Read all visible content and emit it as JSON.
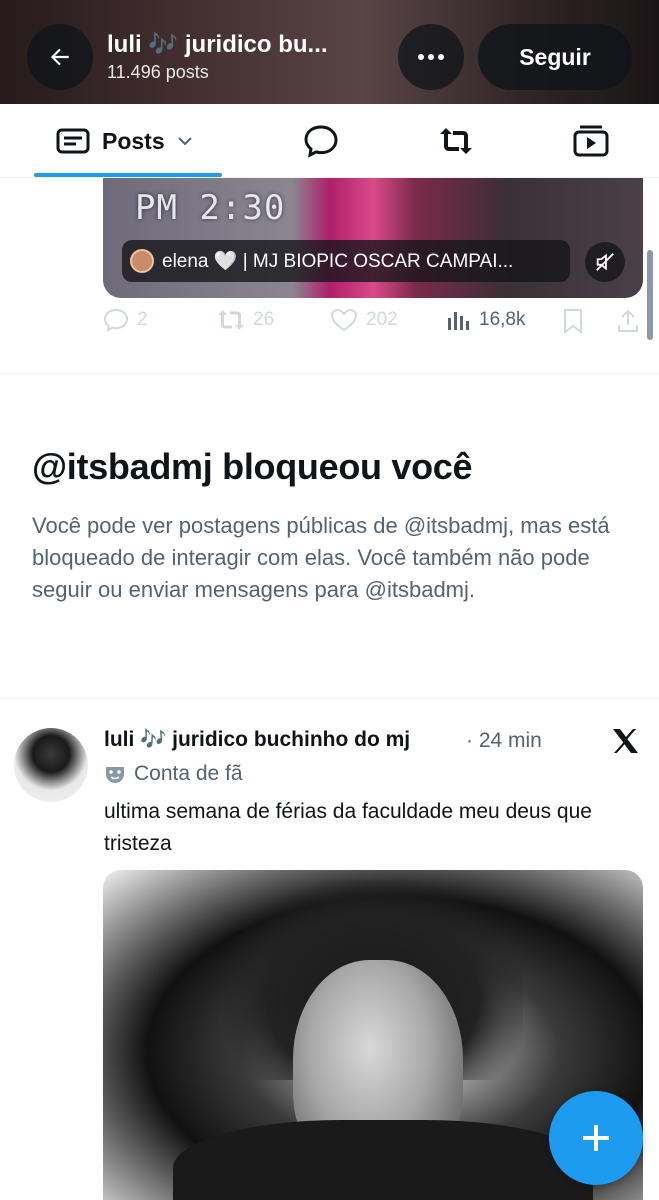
{
  "header": {
    "title": "luli 🎶 juridico bu...",
    "post_count": "11.496 posts",
    "follow_label": "Seguir"
  },
  "tabs": {
    "posts_label": "Posts"
  },
  "post1": {
    "media_timestamp": "PM 2:30",
    "overlay_text": "elena 🤍 | MJ BIOPIC OSCAR CAMPAI...",
    "replies": "2",
    "reposts": "26",
    "likes": "202",
    "views": "16,8k"
  },
  "blocked": {
    "title": "@itsbadmj bloqueou você",
    "body": "Você pode ver postagens públicas de @itsbadmj, mas está bloqueado de interagir com elas. Você também não pode seguir ou enviar mensagens para @itsbadmj."
  },
  "post2": {
    "author": "luli 🎶 juridico buchinho do mj",
    "time": "· 24 min",
    "badge": "Conta de fã",
    "text": "ultima semana de férias da faculdade meu deus que tristeza"
  },
  "colors": {
    "accent": "#1d9bf0",
    "text_primary": "#0f1419",
    "text_secondary": "#536471"
  },
  "icons": [
    "back-arrow-icon",
    "more-icon",
    "timeline-icon",
    "chevron-down-icon",
    "reply-icon",
    "repost-icon",
    "media-icon",
    "muted-icon",
    "like-icon",
    "views-icon",
    "bookmark-icon",
    "share-icon",
    "x-logo-icon",
    "mask-icon",
    "plus-icon"
  ]
}
